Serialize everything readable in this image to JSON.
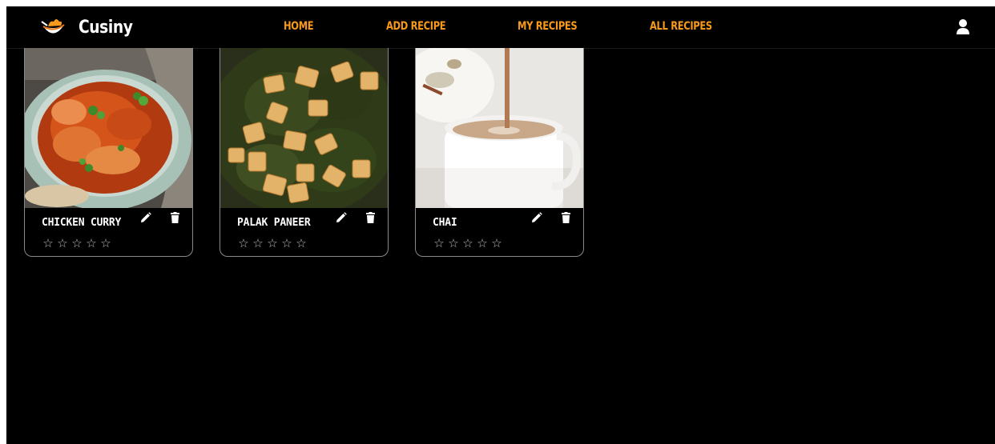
{
  "app": {
    "brand_name": "Cusiny",
    "accent_color": "#f79a1c",
    "background": "#000000"
  },
  "nav": {
    "links": [
      {
        "label": "HOME"
      },
      {
        "label": "ADD RECIPE"
      },
      {
        "label": "MY RECIPES"
      },
      {
        "label": "ALL RECIPES"
      }
    ],
    "profile_icon": "user-icon"
  },
  "recipes": [
    {
      "title": "CHICKEN CURRY",
      "image": "chicken-curry-photo",
      "rating": 0,
      "max_rating": 5
    },
    {
      "title": "PALAK PANEER",
      "image": "palak-paneer-photo",
      "rating": 0,
      "max_rating": 5
    },
    {
      "title": "CHAI",
      "image": "chai-photo",
      "rating": 0,
      "max_rating": 5
    }
  ],
  "card_actions": {
    "edit_icon": "pencil-icon",
    "delete_icon": "trash-icon"
  },
  "star_glyph": "☆"
}
